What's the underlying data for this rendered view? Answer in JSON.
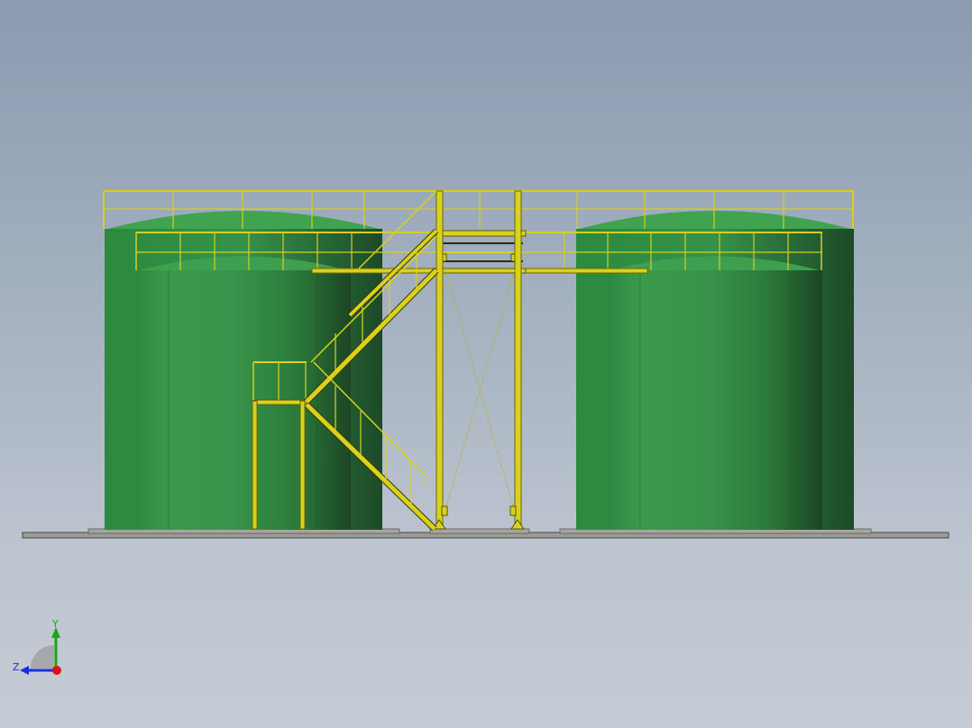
{
  "viewport": {
    "background_top": "#8a9bb0",
    "background_bottom": "#c6ccd5"
  },
  "colors": {
    "tank_light": "#3c9a4c",
    "tank_mid": "#2f8a40",
    "tank_dark": "#1f4f2a",
    "dome": "#3fa350",
    "steel": "#d9d21c",
    "steel_dark": "#6b6410",
    "ground": "#9e9e98"
  },
  "triad": {
    "y_label": "Y",
    "z_label": "Z",
    "x_axis_color": "#e01010",
    "y_axis_color": "#18a818",
    "z_axis_color": "#1830d8"
  }
}
